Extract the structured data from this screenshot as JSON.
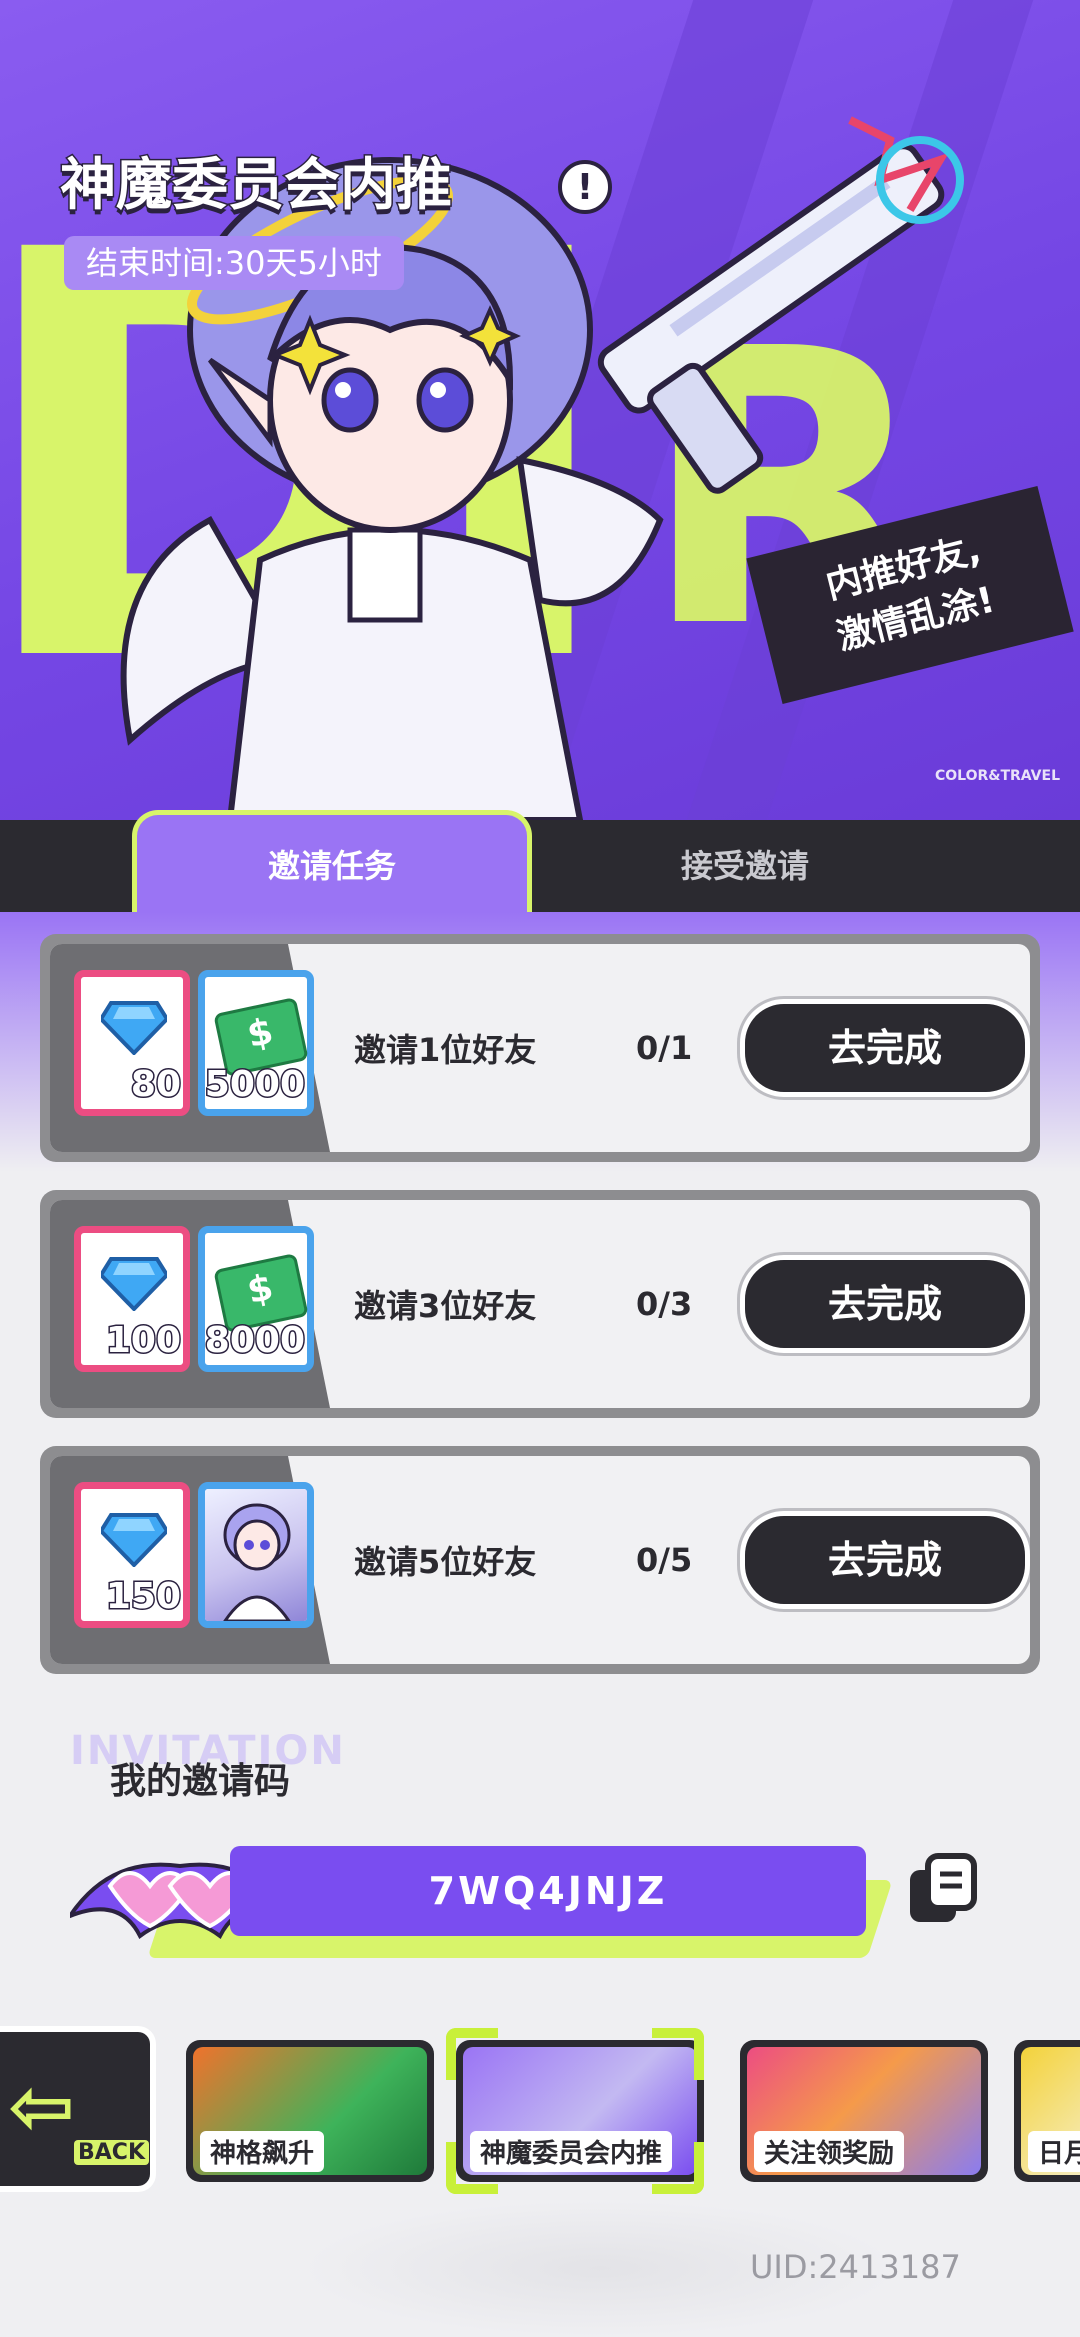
{
  "hero": {
    "title": "神魔委员会内推",
    "info_icon": "info-icon",
    "end_time": "结束时间:30天5小时",
    "promo_line1": "内推好友,",
    "promo_line2": "激情乱涂!",
    "brand_mark": "COLOR&TRAVEL"
  },
  "tabs": {
    "active": "邀请任务",
    "inactive": "接受邀请"
  },
  "tasks": [
    {
      "rewards": [
        {
          "type": "gem",
          "amount": "80"
        },
        {
          "type": "cash",
          "amount": "5000"
        }
      ],
      "name": "邀请1位好友",
      "progress": "0/1",
      "button": "去完成"
    },
    {
      "rewards": [
        {
          "type": "gem",
          "amount": "100"
        },
        {
          "type": "cash",
          "amount": "8000"
        }
      ],
      "name": "邀请3位好友",
      "progress": "0/3",
      "button": "去完成"
    },
    {
      "rewards": [
        {
          "type": "gem",
          "amount": "150"
        },
        {
          "type": "character-portrait",
          "amount": ""
        }
      ],
      "name": "邀请5位好友",
      "progress": "0/5",
      "button": "去完成"
    }
  ],
  "invite": {
    "watermark": "INVITATION",
    "label": "我的邀请码",
    "code": "7WQ4JNJZ",
    "copy_icon": "copy-icon"
  },
  "nav": {
    "back_label": "BACK",
    "items": [
      {
        "label": "神格飙升",
        "selected": false
      },
      {
        "label": "神魔委员会内推",
        "selected": true
      },
      {
        "label": "关注领奖励",
        "selected": false
      },
      {
        "label": "日月",
        "selected": false
      }
    ]
  },
  "footer": {
    "uid": "UID:2413187"
  },
  "colors": {
    "accent_purple": "#7a4df0",
    "accent_lime": "#d8f46a",
    "dark": "#2b2a30",
    "pink_frame": "#ec4d82",
    "blue_frame": "#4aa3ec"
  }
}
